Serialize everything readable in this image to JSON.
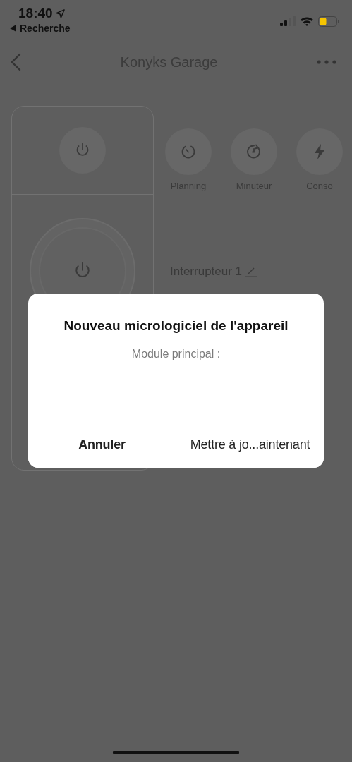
{
  "status_bar": {
    "time": "18:40",
    "back_app": "Recherche"
  },
  "nav": {
    "title": "Konyks Garage"
  },
  "actions": [
    {
      "kind": "schedule",
      "label": "Planning"
    },
    {
      "kind": "timer",
      "label": "Minuteur"
    },
    {
      "kind": "energy",
      "label": "Conso"
    }
  ],
  "switch": {
    "name": "Interrupteur 1"
  },
  "dialog": {
    "title": "Nouveau micrologiciel de l'appareil",
    "message": "Module principal :",
    "buttons": [
      {
        "kind": "cancel",
        "label": "Annuler"
      },
      {
        "kind": "confirm",
        "label": "Mettre à jo...aintenant"
      }
    ]
  }
}
